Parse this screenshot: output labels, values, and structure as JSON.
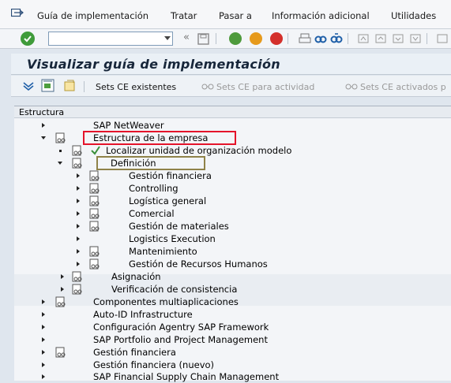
{
  "menu": {
    "items": [
      "Guía de implementación",
      "Tratar",
      "Pasar a",
      "Información adicional",
      "Utilidades"
    ]
  },
  "toolbar": {
    "command_value": ""
  },
  "page": {
    "title": "Visualizar guía de implementación"
  },
  "app_toolbar": {
    "sets_ce_existentes": "Sets CE existentes",
    "sets_ce_actividad": "Sets CE para actividad",
    "sets_ce_activados": "Sets CE activados p"
  },
  "tree": {
    "header": "Estructura",
    "nodes": [
      {
        "label": "SAP NetWeaver"
      },
      {
        "label": "Estructura de la empresa"
      },
      {
        "label": "Localizar unidad de organización modelo"
      },
      {
        "label": "Definición"
      },
      {
        "label": "Gestión financiera"
      },
      {
        "label": "Controlling"
      },
      {
        "label": "Logística general"
      },
      {
        "label": "Comercial"
      },
      {
        "label": "Gestión de materiales"
      },
      {
        "label": "Logistics Execution"
      },
      {
        "label": "Mantenimiento"
      },
      {
        "label": "Gestión de Recursos Humanos"
      },
      {
        "label": "Asignación"
      },
      {
        "label": "Verificación de consistencia"
      },
      {
        "label": "Componentes multiaplicaciones"
      },
      {
        "label": "Auto-ID Infrastructure"
      },
      {
        "label": "Configuración Agentry SAP Framework"
      },
      {
        "label": "SAP Portfolio and Project Management"
      },
      {
        "label": "Gestión financiera"
      },
      {
        "label": "Gestión financiera (nuevo)"
      },
      {
        "label": "SAP Financial Supply Chain Management"
      }
    ]
  },
  "colors": {
    "highlight_red": "#e4132a",
    "highlight_olive": "#8f8248",
    "ok_green": "#3f9b3a"
  }
}
